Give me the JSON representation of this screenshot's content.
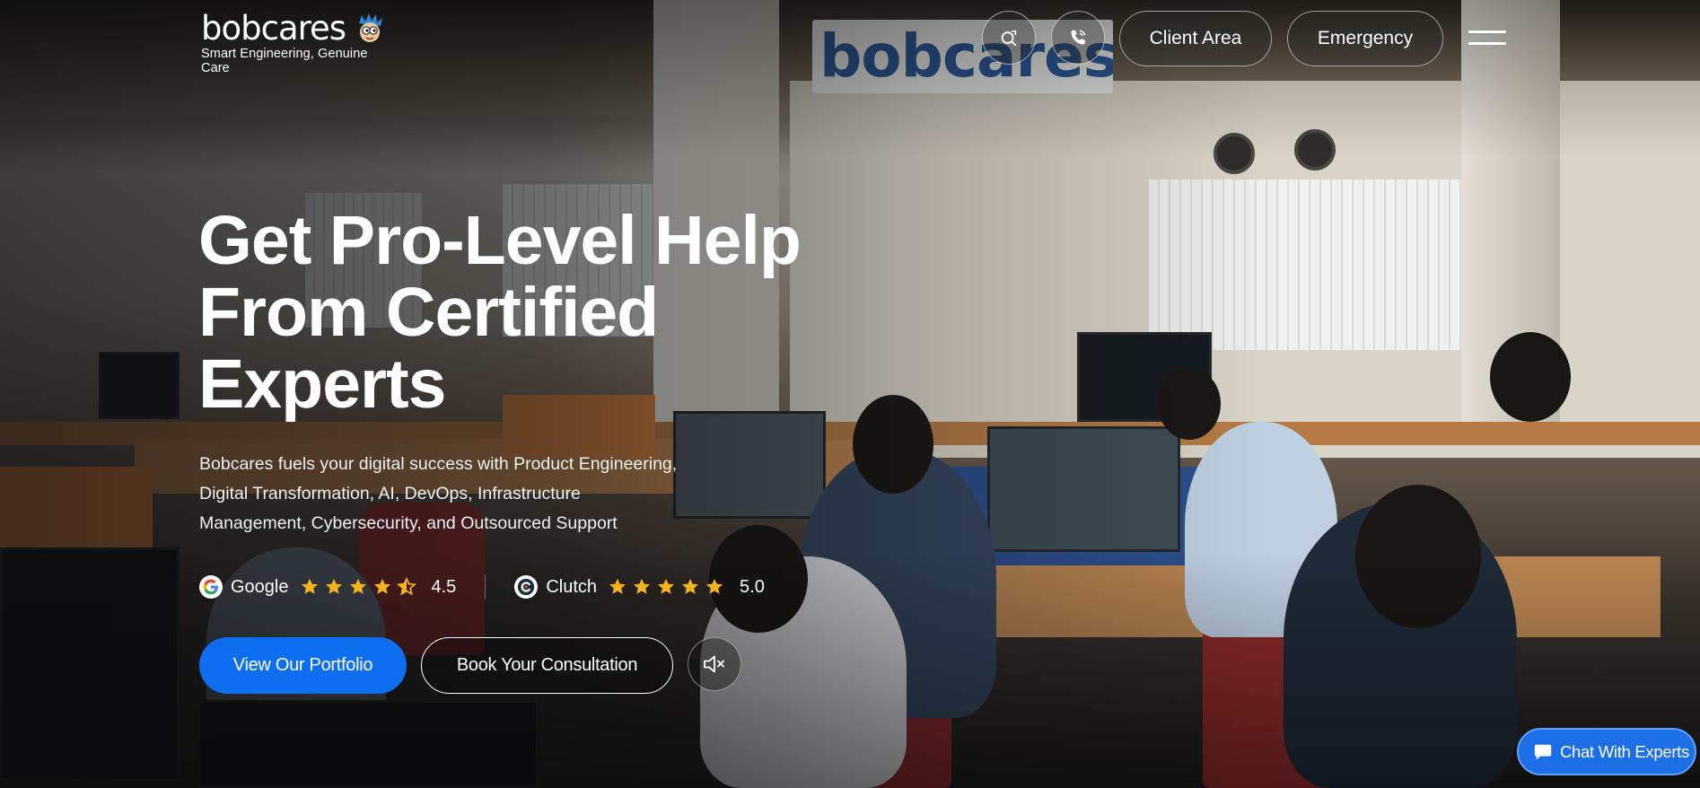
{
  "brand": {
    "name": "bobcares",
    "tagline": "Smart Engineering, Genuine Care"
  },
  "header": {
    "search_icon": "search-icon",
    "phone_icon": "phone-icon",
    "client_area_label": "Client Area",
    "emergency_label": "Emergency",
    "menu_icon": "hamburger-menu-icon"
  },
  "hero": {
    "title_lines": [
      "Get Pro-Level Help",
      "From Certified",
      "Experts"
    ],
    "description_lines": [
      "Bobcares fuels your digital success with Product Engineering,",
      "Digital Transformation, AI, DevOps, Infrastructure",
      "Management, Cybersecurity, and Outsourced Support"
    ],
    "ratings": [
      {
        "name": "Google",
        "icon": "google-logo-icon",
        "score": "4.5",
        "stars": 4.5
      },
      {
        "name": "Clutch",
        "icon": "clutch-logo-icon",
        "score": "5.0",
        "stars": 5
      }
    ],
    "primary_button": "View Our Portfolio",
    "secondary_button": "Book Your Consultation",
    "mute_icon": "volume-mute-icon"
  },
  "chat": {
    "label": "Chat With Experts",
    "icon": "chat-bubble-icon"
  },
  "colors": {
    "primary": "#0d6eef",
    "star": "#f5b21b",
    "sign_text": "#2c5a9a"
  },
  "background": {
    "sign_text": "bobcares"
  }
}
